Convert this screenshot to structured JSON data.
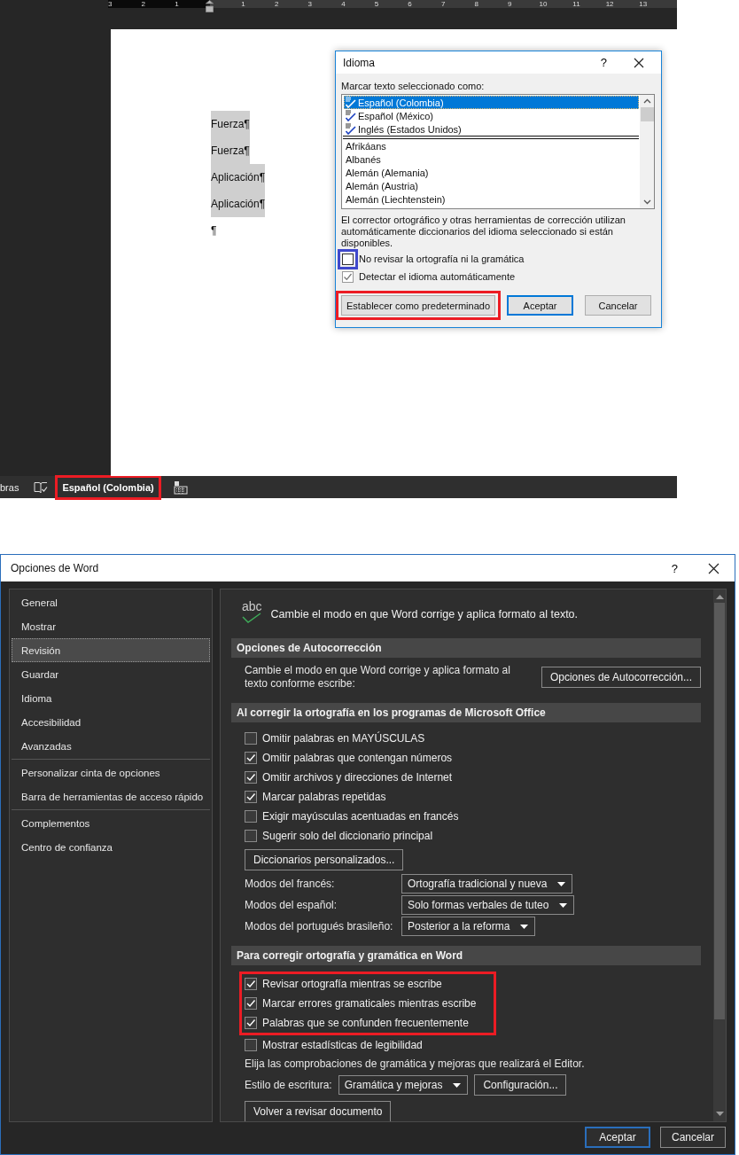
{
  "document": {
    "ruler": [
      "3",
      "2",
      "1",
      "1",
      "2",
      "3",
      "4",
      "5",
      "6",
      "7",
      "8",
      "9",
      "10",
      "11",
      "12",
      "13"
    ],
    "paragraphs": [
      {
        "text": "Fuerza¶",
        "highlighted": true
      },
      {
        "text": "Fuerza¶",
        "highlighted": true
      },
      {
        "text": "Aplicación¶",
        "highlighted": true
      },
      {
        "text": "Aplicación¶",
        "highlighted": true
      },
      {
        "text": "¶",
        "highlighted": false
      }
    ]
  },
  "status_bar": {
    "word_count": "bras",
    "language": "Español (Colombia)",
    "language_outlined": true
  },
  "language_dialog": {
    "title": "Idioma",
    "help": "?",
    "list_label": "Marcar texto seleccionado como:",
    "languages": [
      {
        "name": "Español (Colombia)",
        "kind": "favorite",
        "selected": true
      },
      {
        "name": "Español (México)",
        "kind": "favorite",
        "selected": false
      },
      {
        "name": "Inglés (Estados Unidos)",
        "kind": "favorite",
        "selected": false
      },
      {
        "name": "Afrikáans",
        "kind": "plain",
        "selected": false
      },
      {
        "name": "Albanés",
        "kind": "plain",
        "selected": false
      },
      {
        "name": "Alemán (Alemania)",
        "kind": "plain",
        "selected": false
      },
      {
        "name": "Alemán (Austria)",
        "kind": "plain",
        "selected": false
      },
      {
        "name": "Alemán (Liechtenstein)",
        "kind": "plain",
        "selected": false
      }
    ],
    "note": "El corrector ortográfico y otras herramientas de corrección utilizan automáticamente diccionarios del idioma seleccionado si están disponibles.",
    "options": [
      {
        "label": "No revisar la ortografía ni la gramática",
        "checked": false,
        "disabled": false,
        "outlined": true
      },
      {
        "label": "Detectar el idioma automáticamente",
        "checked": true,
        "disabled": true,
        "outlined": false
      }
    ],
    "buttons": [
      {
        "label": "Establecer como predeterminado",
        "default": false,
        "outlined": true
      },
      {
        "label": "Aceptar",
        "default": true,
        "outlined": false
      },
      {
        "label": "Cancelar",
        "default": false,
        "outlined": false
      }
    ]
  },
  "word_options": {
    "title": "Opciones de Word",
    "help": "?",
    "nav": [
      {
        "items": [
          {
            "label": "General",
            "selected": false
          },
          {
            "label": "Mostrar",
            "selected": false
          },
          {
            "label": "Revisión",
            "selected": true
          },
          {
            "label": "Guardar",
            "selected": false
          },
          {
            "label": "Idioma",
            "selected": false
          },
          {
            "label": "Accesibilidad",
            "selected": false
          },
          {
            "label": "Avanzadas",
            "selected": false
          }
        ]
      },
      {
        "items": [
          {
            "label": "Personalizar cinta de opciones",
            "selected": false
          },
          {
            "label": "Barra de herramientas de acceso rápido",
            "selected": false
          }
        ]
      },
      {
        "items": [
          {
            "label": "Complementos",
            "selected": false
          },
          {
            "label": "Centro de confianza",
            "selected": false
          }
        ]
      }
    ],
    "header": {
      "icon_text": "abc",
      "text": "Cambie el modo en que Word corrige y aplica formato al texto."
    },
    "sections": [
      {
        "title": "Opciones de Autocorrección",
        "rows": [
          {
            "kind": "text_button",
            "text": "Cambie el modo en que Word corrige y aplica formato al texto conforme escribe:",
            "button": "Opciones de Autocorrección..."
          }
        ]
      },
      {
        "title": "Al corregir la ortografía en los programas de Microsoft Office",
        "rows": [
          {
            "kind": "check",
            "label": "Omitir palabras en MAYÚSCULAS",
            "checked": false
          },
          {
            "kind": "check",
            "label": "Omitir palabras que contengan números",
            "checked": true
          },
          {
            "kind": "check",
            "label": "Omitir archivos y direcciones de Internet",
            "checked": true
          },
          {
            "kind": "check",
            "label": "Marcar palabras repetidas",
            "checked": true
          },
          {
            "kind": "check",
            "label": "Exigir mayúsculas acentuadas en francés",
            "checked": false
          },
          {
            "kind": "check",
            "label": "Sugerir solo del diccionario principal",
            "checked": false
          },
          {
            "kind": "button",
            "label": "Diccionarios personalizados..."
          },
          {
            "kind": "select",
            "label": "Modos del francés:",
            "value": "Ortografía tradicional y nueva"
          },
          {
            "kind": "select",
            "label": "Modos del español:",
            "value": "Solo formas verbales de tuteo"
          },
          {
            "kind": "select",
            "label": "Modos del portugués brasileño:",
            "value": "Posterior a la reforma"
          }
        ]
      },
      {
        "title": "Para corregir ortografía y gramática en Word",
        "rows": [
          {
            "kind": "check_group",
            "outlined": true,
            "items": [
              {
                "label": "Revisar ortografía mientras se escribe",
                "checked": true
              },
              {
                "label": "Marcar errores gramaticales mientras escribe",
                "checked": true
              },
              {
                "label": "Palabras que se confunden frecuentemente",
                "checked": true
              }
            ]
          },
          {
            "kind": "check",
            "label": "Mostrar estadísticas de legibilidad",
            "checked": false
          },
          {
            "kind": "text",
            "text": "Elija las comprobaciones de gramática y mejoras que realizará el Editor."
          },
          {
            "kind": "select_button",
            "label": "Estilo de escritura:",
            "value": "Gramática y mejoras",
            "button": "Configuración..."
          },
          {
            "kind": "button",
            "label": "Volver a revisar documento"
          }
        ]
      }
    ],
    "buttons": [
      {
        "label": "Aceptar",
        "default": true
      },
      {
        "label": "Cancelar",
        "default": false
      }
    ]
  }
}
